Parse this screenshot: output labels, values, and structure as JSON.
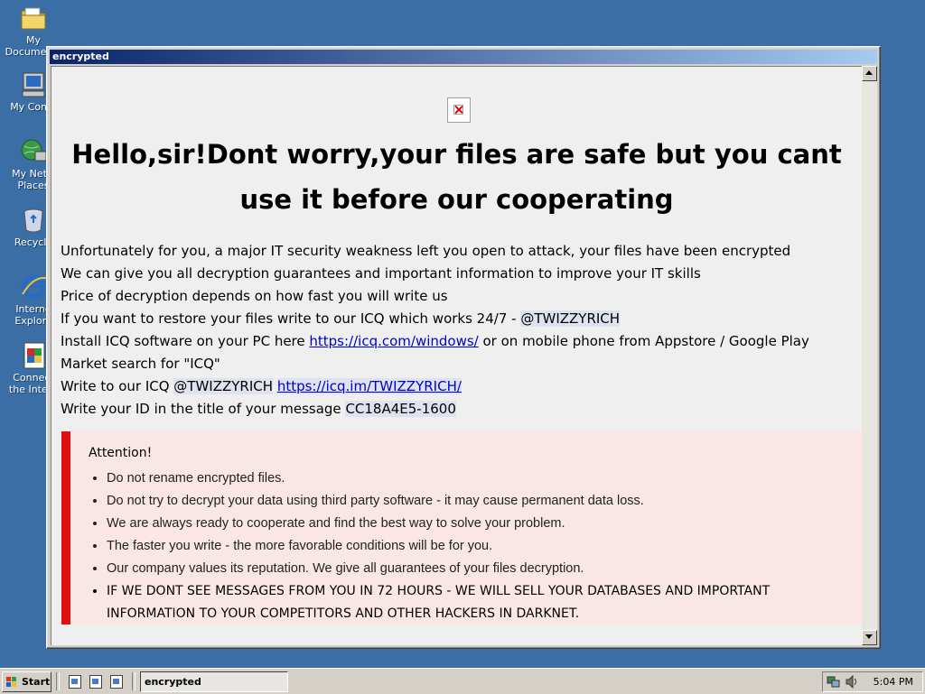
{
  "desktop": {
    "icons": [
      {
        "label": "My Documents",
        "icon": "my-documents-icon"
      },
      {
        "label": "My Comp",
        "icon": "my-computer-icon"
      },
      {
        "label": "My Netw\nPlaces",
        "icon": "network-places-icon"
      },
      {
        "label": "Recycle",
        "icon": "recycle-bin-icon"
      },
      {
        "label": "Interne\nExplore",
        "icon": "internet-explorer-icon"
      },
      {
        "label": "Connect\nthe Intern",
        "icon": "connect-internet-icon"
      }
    ]
  },
  "window": {
    "title": "encrypted",
    "headline": "Hello,sir!Dont worry,your files are safe but you cant use it before our cooperating",
    "lines": {
      "l1": "Unfortunately for you, a major IT security weakness left you open to attack, your files have been encrypted",
      "l2": "We can give you all decryption guarantees and important information to improve your IT skills",
      "l3": "Price of decryption depends on how fast you will write us",
      "l4_pre": "If you want to restore your files write to our ICQ which works 24/7 - ",
      "l4_handle": "@TWIZZYRICH",
      "l5_pre": "Install ICQ software on your PC here ",
      "l5_link": "https://icq.com/windows/",
      "l5_post": " or on mobile phone from Appstore / Google Play Market search for \"ICQ\"",
      "l6_pre": "Write to our ICQ ",
      "l6_handle": "@TWIZZYRICH",
      "l6_link": "https://icq.im/TWIZZYRICH/",
      "l7_pre": "Write your ID in the title of your message ",
      "l7_id": "CC18A4E5-1600"
    },
    "attention": {
      "title": "Attention!",
      "items": [
        "Do not rename encrypted files.",
        "Do not try to decrypt your data using third party software - it may cause permanent data loss.",
        "We are always ready to cooperate and find the best way to solve your problem.",
        "The faster you write - the more favorable conditions will be for you.",
        "Our company values its reputation. We give all guarantees of your files decryption.",
        "IF WE DONT SEE MESSAGES FROM YOU IN 72 HOURS - WE WILL SELL YOUR DATABASES AND IMPORTANT INFORMATION TO YOUR COMPETITORS AND OTHER HACKERS IN DARKNET."
      ]
    },
    "colors": {
      "accent_red": "#e01010",
      "attention_bg": "#fbe6e6",
      "titlebar": "#0a246a"
    }
  },
  "taskbar": {
    "start_label": "Start",
    "task_label": "encrypted",
    "clock": "5:04 PM"
  }
}
